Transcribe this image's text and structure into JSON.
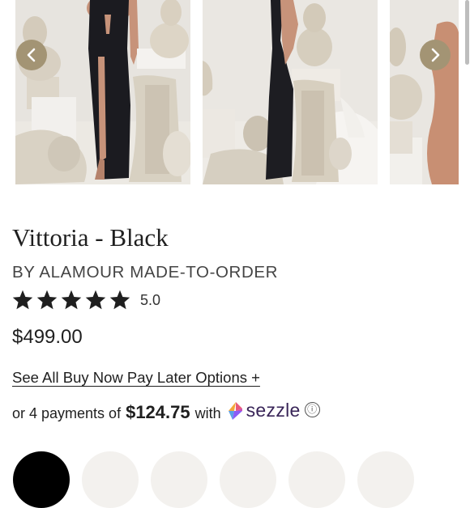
{
  "gallery": {
    "prev_icon": "chevron-left-icon",
    "next_icon": "chevron-right-icon",
    "nav_color": "#a39474"
  },
  "product": {
    "name": "Vittoria - Black",
    "brand": "BY ALAMOUR MADE-TO-ORDER",
    "rating": 5,
    "rating_text": "5.0",
    "price": "$499.00"
  },
  "payment": {
    "bnpl_link": "See All Buy Now Pay Later Options +",
    "installments_prefix": "or 4 payments of",
    "installment_amount": "$124.75",
    "installments_with": "with",
    "provider": "sezzle",
    "info_icon": "ⓘ"
  },
  "colors": {
    "swatch_selected": "#000000",
    "swatch_other": "#f3f1ee"
  }
}
